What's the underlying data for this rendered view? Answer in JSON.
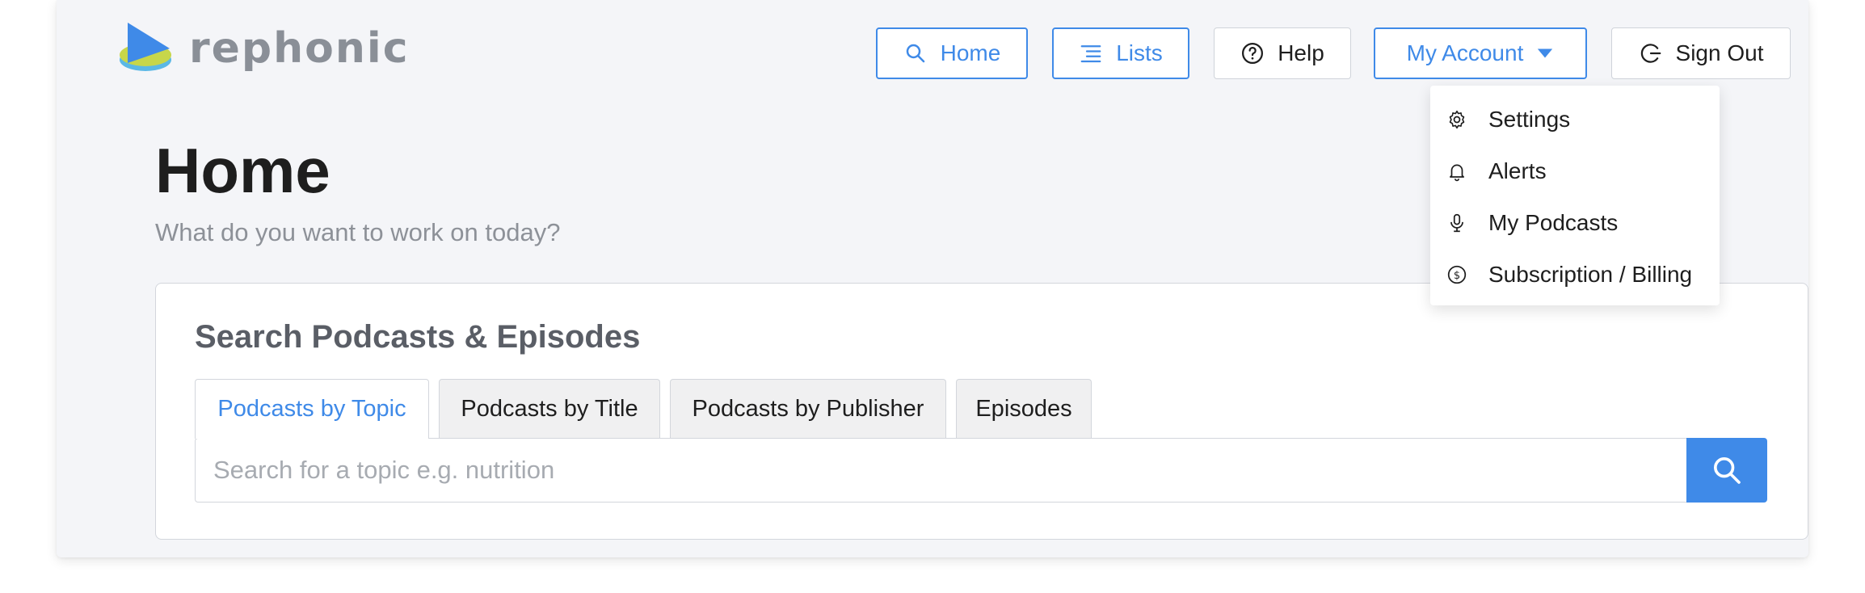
{
  "brand": {
    "name": "rephonic"
  },
  "nav": {
    "home_label": "Home",
    "lists_label": "Lists",
    "help_label": "Help",
    "account_label": "My Account",
    "signout_label": "Sign Out"
  },
  "account_menu": {
    "items": [
      {
        "label": "Settings",
        "icon": "gear-icon"
      },
      {
        "label": "Alerts",
        "icon": "bell-icon"
      },
      {
        "label": "My Podcasts",
        "icon": "microphone-icon"
      },
      {
        "label": "Subscription / Billing",
        "icon": "dollar-circle-icon"
      }
    ]
  },
  "page": {
    "title": "Home",
    "subtitle": "What do you want to work on today?"
  },
  "search": {
    "heading": "Search Podcasts & Episodes",
    "tabs": [
      {
        "label": "Podcasts by Topic",
        "active": true
      },
      {
        "label": "Podcasts by Title",
        "active": false
      },
      {
        "label": "Podcasts by Publisher",
        "active": false
      },
      {
        "label": "Episodes",
        "active": false
      }
    ],
    "placeholder": "Search for a topic e.g. nutrition",
    "value": ""
  },
  "colors": {
    "accent": "#3f8ae8",
    "background": "#f4f5f8",
    "text": "#1e1e1e",
    "muted": "#8d9198"
  }
}
